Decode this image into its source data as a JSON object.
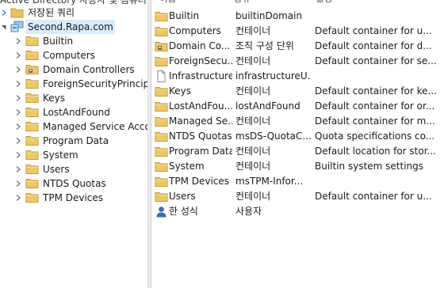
{
  "tree": {
    "top_clip": "Active Directory 사용자 및 컴퓨터",
    "saved_queries": "저장된 쿼리",
    "domain": "Second.Rapa.com",
    "children": [
      {
        "label": "Builtin",
        "icon": "folder-icon"
      },
      {
        "label": "Computers",
        "icon": "folder-icon"
      },
      {
        "label": "Domain Controllers",
        "icon": "ou-folder-icon"
      },
      {
        "label": "ForeignSecurityPrincipals",
        "icon": "folder-icon"
      },
      {
        "label": "Keys",
        "icon": "folder-icon"
      },
      {
        "label": "LostAndFound",
        "icon": "folder-icon"
      },
      {
        "label": "Managed Service Accou",
        "icon": "folder-icon"
      },
      {
        "label": "Program Data",
        "icon": "folder-icon"
      },
      {
        "label": "System",
        "icon": "folder-icon"
      },
      {
        "label": "Users",
        "icon": "folder-icon"
      },
      {
        "label": "NTDS Quotas",
        "icon": "folder-icon"
      },
      {
        "label": "TPM Devices",
        "icon": "folder-icon"
      }
    ]
  },
  "list": {
    "columns": {
      "name": "이름",
      "type": "종류",
      "desc": "설명"
    },
    "rows": [
      {
        "name": "Builtin",
        "type": "builtinDomain",
        "desc": "",
        "icon": "folder-icon"
      },
      {
        "name": "Computers",
        "type": "컨테이너",
        "desc": "Default container for u...",
        "icon": "folder-icon"
      },
      {
        "name": "Domain Co...",
        "type": "조직 구성 단위",
        "desc": "Default container for d...",
        "icon": "ou-folder-icon"
      },
      {
        "name": "ForeignSecu...",
        "type": "컨테이너",
        "desc": "Default container for se...",
        "icon": "folder-icon"
      },
      {
        "name": "Infrastructure",
        "type": "infrastructureU...",
        "desc": "",
        "icon": "document-icon"
      },
      {
        "name": "Keys",
        "type": "컨테이너",
        "desc": "Default container for ke...",
        "icon": "folder-icon"
      },
      {
        "name": "LostAndFou...",
        "type": "lostAndFound",
        "desc": "Default container for or...",
        "icon": "folder-icon"
      },
      {
        "name": "Managed Se...",
        "type": "컨테이너",
        "desc": "Default container for m...",
        "icon": "folder-icon"
      },
      {
        "name": "NTDS Quotas",
        "type": "msDS-QuotaC...",
        "desc": "Quota specifications co...",
        "icon": "folder-icon"
      },
      {
        "name": "Program Data",
        "type": "컨테이너",
        "desc": "Default location for stor...",
        "icon": "folder-icon"
      },
      {
        "name": "System",
        "type": "컨테이너",
        "desc": "Builtin system settings",
        "icon": "folder-icon"
      },
      {
        "name": "TPM Devices",
        "type": "msTPM-Infor...",
        "desc": "",
        "icon": "folder-icon"
      },
      {
        "name": "Users",
        "type": "컨테이너",
        "desc": "Default container for u...",
        "icon": "folder-icon"
      },
      {
        "name": "한 성식",
        "type": "사용자",
        "desc": "",
        "icon": "user-icon"
      }
    ]
  },
  "colors": {
    "folder": "#e8c060",
    "folder_dark": "#c99a2e",
    "selection": "#d9ecfb",
    "chevron": "#6f6f6f",
    "user": "#3a6ea8"
  }
}
